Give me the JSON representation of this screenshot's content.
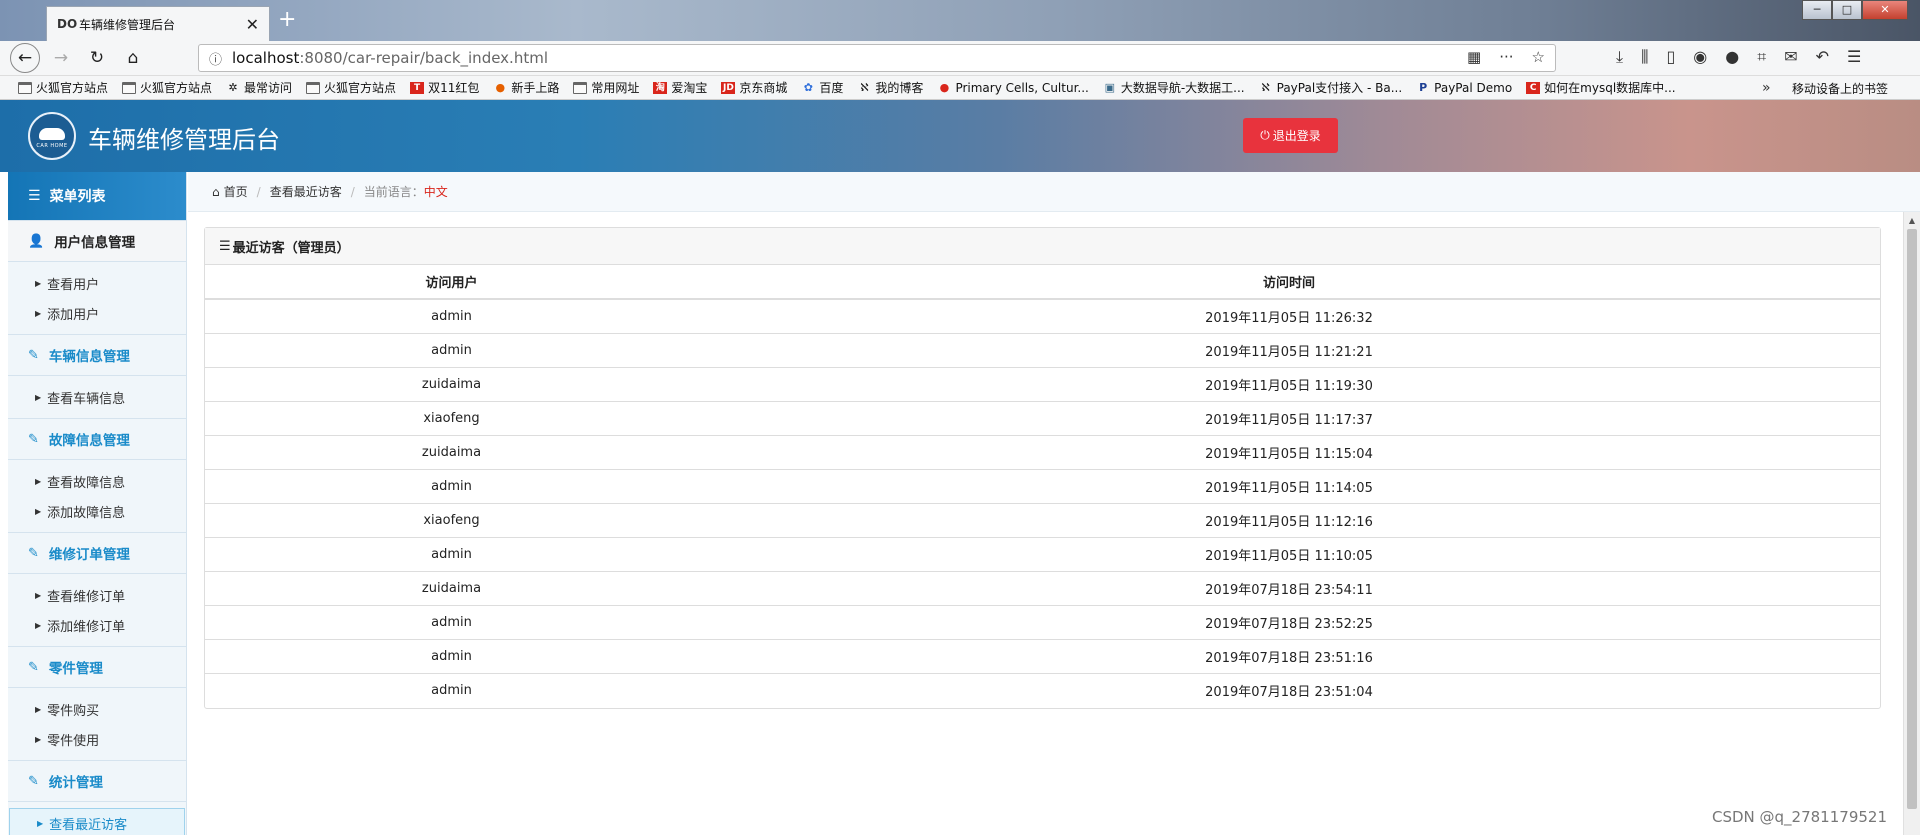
{
  "browser": {
    "tab_title": "车辆维修管理后台",
    "tab_favicon": "DO",
    "url_host": "localhost",
    "url_path": ":8080/car-repair/back_index.html",
    "bookmarks": [
      {
        "label": "火狐官方站点",
        "icon": "folder-icon"
      },
      {
        "label": "火狐官方站点",
        "icon": "folder-icon"
      },
      {
        "label": "最常访问",
        "icon": "gear-icon"
      },
      {
        "label": "火狐官方站点",
        "icon": "folder-icon"
      },
      {
        "label": "双11红包",
        "icon": "tmall-icon"
      },
      {
        "label": "新手上路",
        "icon": "firefox-icon"
      },
      {
        "label": "常用网址",
        "icon": "folder-icon"
      },
      {
        "label": "爱淘宝",
        "icon": "taobao-icon"
      },
      {
        "label": "京东商城",
        "icon": "jd-icon"
      },
      {
        "label": "百度",
        "icon": "baidu-icon"
      },
      {
        "label": "我的博客",
        "icon": "blog-icon"
      },
      {
        "label": "Primary Cells, Cultur...",
        "icon": "site-icon"
      },
      {
        "label": "大数据导航-大数据工...",
        "icon": "site-icon"
      },
      {
        "label": "PayPal支付接入 - Ba...",
        "icon": "blog-icon"
      },
      {
        "label": "PayPal Demo",
        "icon": "paypal-icon"
      },
      {
        "label": "如何在mysql数据库中...",
        "icon": "csdn-icon"
      }
    ],
    "mobile_bookmarks": "移动设备上的书签"
  },
  "header": {
    "title": "车辆维修管理后台",
    "logo_text": "CAR HOME",
    "logout_label": "退出登录",
    "accent_color": "#1d6ea9",
    "logout_color": "#e8333d"
  },
  "sidebar": {
    "menu_title": "菜单列表",
    "groups": [
      {
        "title": "用户信息管理",
        "items": [
          "查看用户",
          "添加用户"
        ]
      },
      {
        "title": "车辆信息管理",
        "items": [
          "查看车辆信息"
        ]
      },
      {
        "title": "故障信息管理",
        "items": [
          "查看故障信息",
          "添加故障信息"
        ]
      },
      {
        "title": "维修订单管理",
        "items": [
          "查看维修订单",
          "添加维修订单"
        ]
      },
      {
        "title": "零件管理",
        "items": [
          "零件购买",
          "零件使用"
        ]
      },
      {
        "title": "统计管理",
        "items": [
          "查看最近访客"
        ]
      }
    ],
    "active_item": "查看最近访客"
  },
  "breadcrumb": {
    "home": "首页",
    "current": "查看最近访客",
    "lang_label": "当前语言：",
    "lang_value": "中文"
  },
  "panel": {
    "title": "最近访客（管理员）",
    "columns": [
      "访问用户",
      "访问时间"
    ],
    "rows": [
      [
        "admin",
        "2019年11月05日 11:26:32"
      ],
      [
        "admin",
        "2019年11月05日 11:21:21"
      ],
      [
        "zuidaima",
        "2019年11月05日 11:19:30"
      ],
      [
        "xiaofeng",
        "2019年11月05日 11:17:37"
      ],
      [
        "zuidaima",
        "2019年11月05日 11:15:04"
      ],
      [
        "admin",
        "2019年11月05日 11:14:05"
      ],
      [
        "xiaofeng",
        "2019年11月05日 11:12:16"
      ],
      [
        "admin",
        "2019年11月05日 11:10:05"
      ],
      [
        "zuidaima",
        "2019年07月18日 23:54:11"
      ],
      [
        "admin",
        "2019年07月18日 23:52:25"
      ],
      [
        "admin",
        "2019年07月18日 23:51:16"
      ],
      [
        "admin",
        "2019年07月18日 23:51:04"
      ]
    ]
  },
  "watermark": "CSDN @q_2781179521"
}
